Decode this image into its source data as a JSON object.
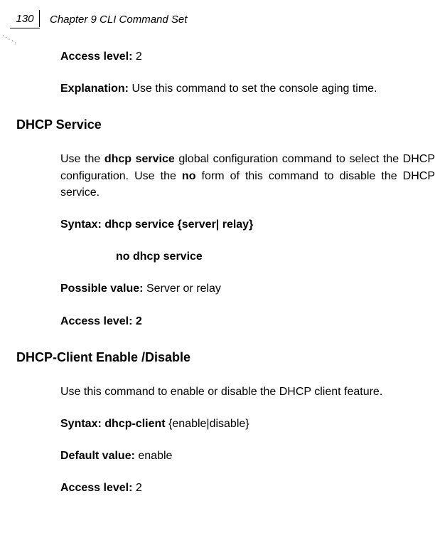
{
  "header": {
    "page_number": "130",
    "chapter_title": "Chapter 9 CLI Command Set"
  },
  "s1": {
    "access_level_label": "Access level:",
    "access_level_value": " 2",
    "explanation_label": "Explanation:",
    "explanation_text": " Use this command to set the console aging time."
  },
  "s2": {
    "heading": "DHCP Service",
    "intro_a": "Use the ",
    "intro_b": "dhcp service",
    "intro_c": " global configuration command to select the DHCP configuration. Use the ",
    "intro_d": "no",
    "intro_e": " form of this command to disable the DHCP service.",
    "syntax_label": "Syntax:",
    "syntax_value1": "   dhcp service {server| relay}",
    "syntax_value2": "no dhcp service",
    "possible_label": "Possible value:",
    "possible_value": " Server or relay",
    "access_level_label": "Access level: 2"
  },
  "s3": {
    "heading": "DHCP-Client Enable /Disable",
    "intro": " Use this command to enable or disable the DHCP client feature.",
    "syntax_label": "Syntax: dhcp-client ",
    "syntax_value": "{enable|disable}",
    "default_label": "Default value:",
    "default_value": " enable",
    "access_level_label": "Access level:",
    "access_level_value": " 2"
  }
}
